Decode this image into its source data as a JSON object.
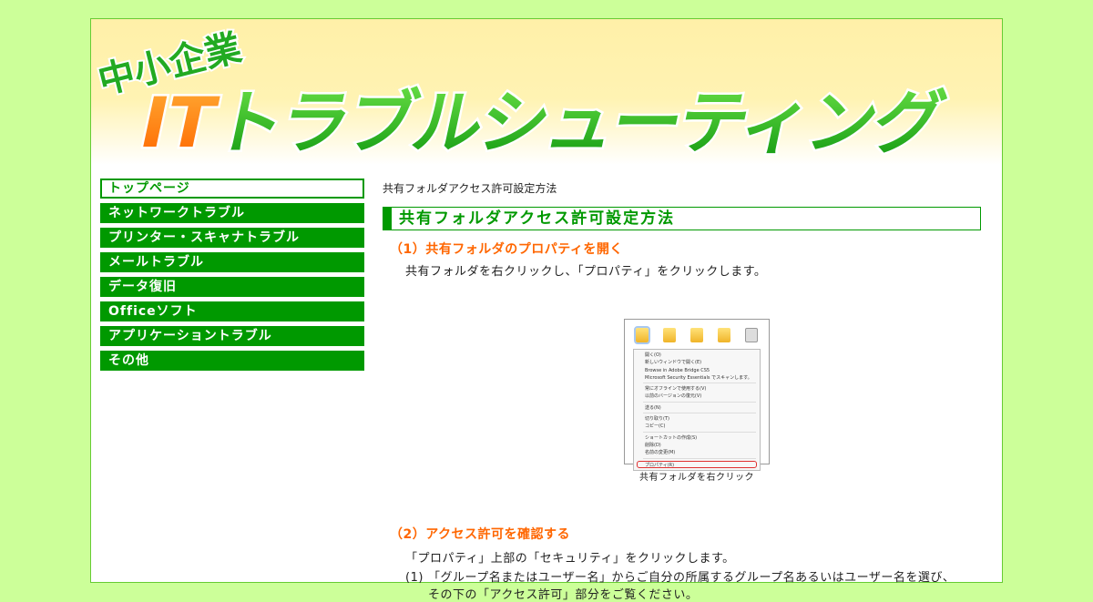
{
  "site": {
    "title_small": "中小企業",
    "title_large_it": "IT",
    "title_large_rest": "トラブルシューティング"
  },
  "sidebar": {
    "items": [
      {
        "label": "トップページ",
        "current": true
      },
      {
        "label": "ネットワークトラブル"
      },
      {
        "label": "プリンター・スキャナトラブル"
      },
      {
        "label": "メールトラブル"
      },
      {
        "label": "データ復旧"
      },
      {
        "label": "Officeソフト"
      },
      {
        "label": "アプリケーショントラブル"
      },
      {
        "label": "その他"
      }
    ]
  },
  "main": {
    "breadcrumb": "共有フォルダアクセス許可設定方法",
    "heading": "共有フォルダアクセス許可設定方法",
    "step1": {
      "title": "（1）共有フォルダのプロパティを開く",
      "text": "共有フォルダを右クリックし、「プロパティ」をクリックします。",
      "figure_caption": "共有フォルダを右クリック",
      "context_menu": [
        "開く(O)",
        "新しいウィンドウで開く(E)",
        "Browse in Adobe Bridge CS5",
        "Microsoft Security Essentials でスキャンします。",
        "常にオフラインで使用する(V)",
        "以前のバージョンの復元(V)",
        "送る(N)",
        "切り取り(T)",
        "コピー(C)",
        "ショートカットの作成(S)",
        "削除(D)",
        "名前の変更(M)",
        "プロパティ(R)"
      ]
    },
    "step2": {
      "title": "（2）アクセス許可を確認する",
      "text": "「プロパティ」上部の「セキュリティ」をクリックします。",
      "list": [
        {
          "num": "(1)",
          "line1": "「グループ名またはユーザー名」からご自分の所属するグループ名あるいはユーザー名を選び、",
          "line2": "その下の「アクセス許可」部分をご覧ください。"
        }
      ]
    }
  },
  "colors": {
    "background": "#ccff99",
    "accent_green": "#009900",
    "heading_orange": "#ff6600"
  }
}
